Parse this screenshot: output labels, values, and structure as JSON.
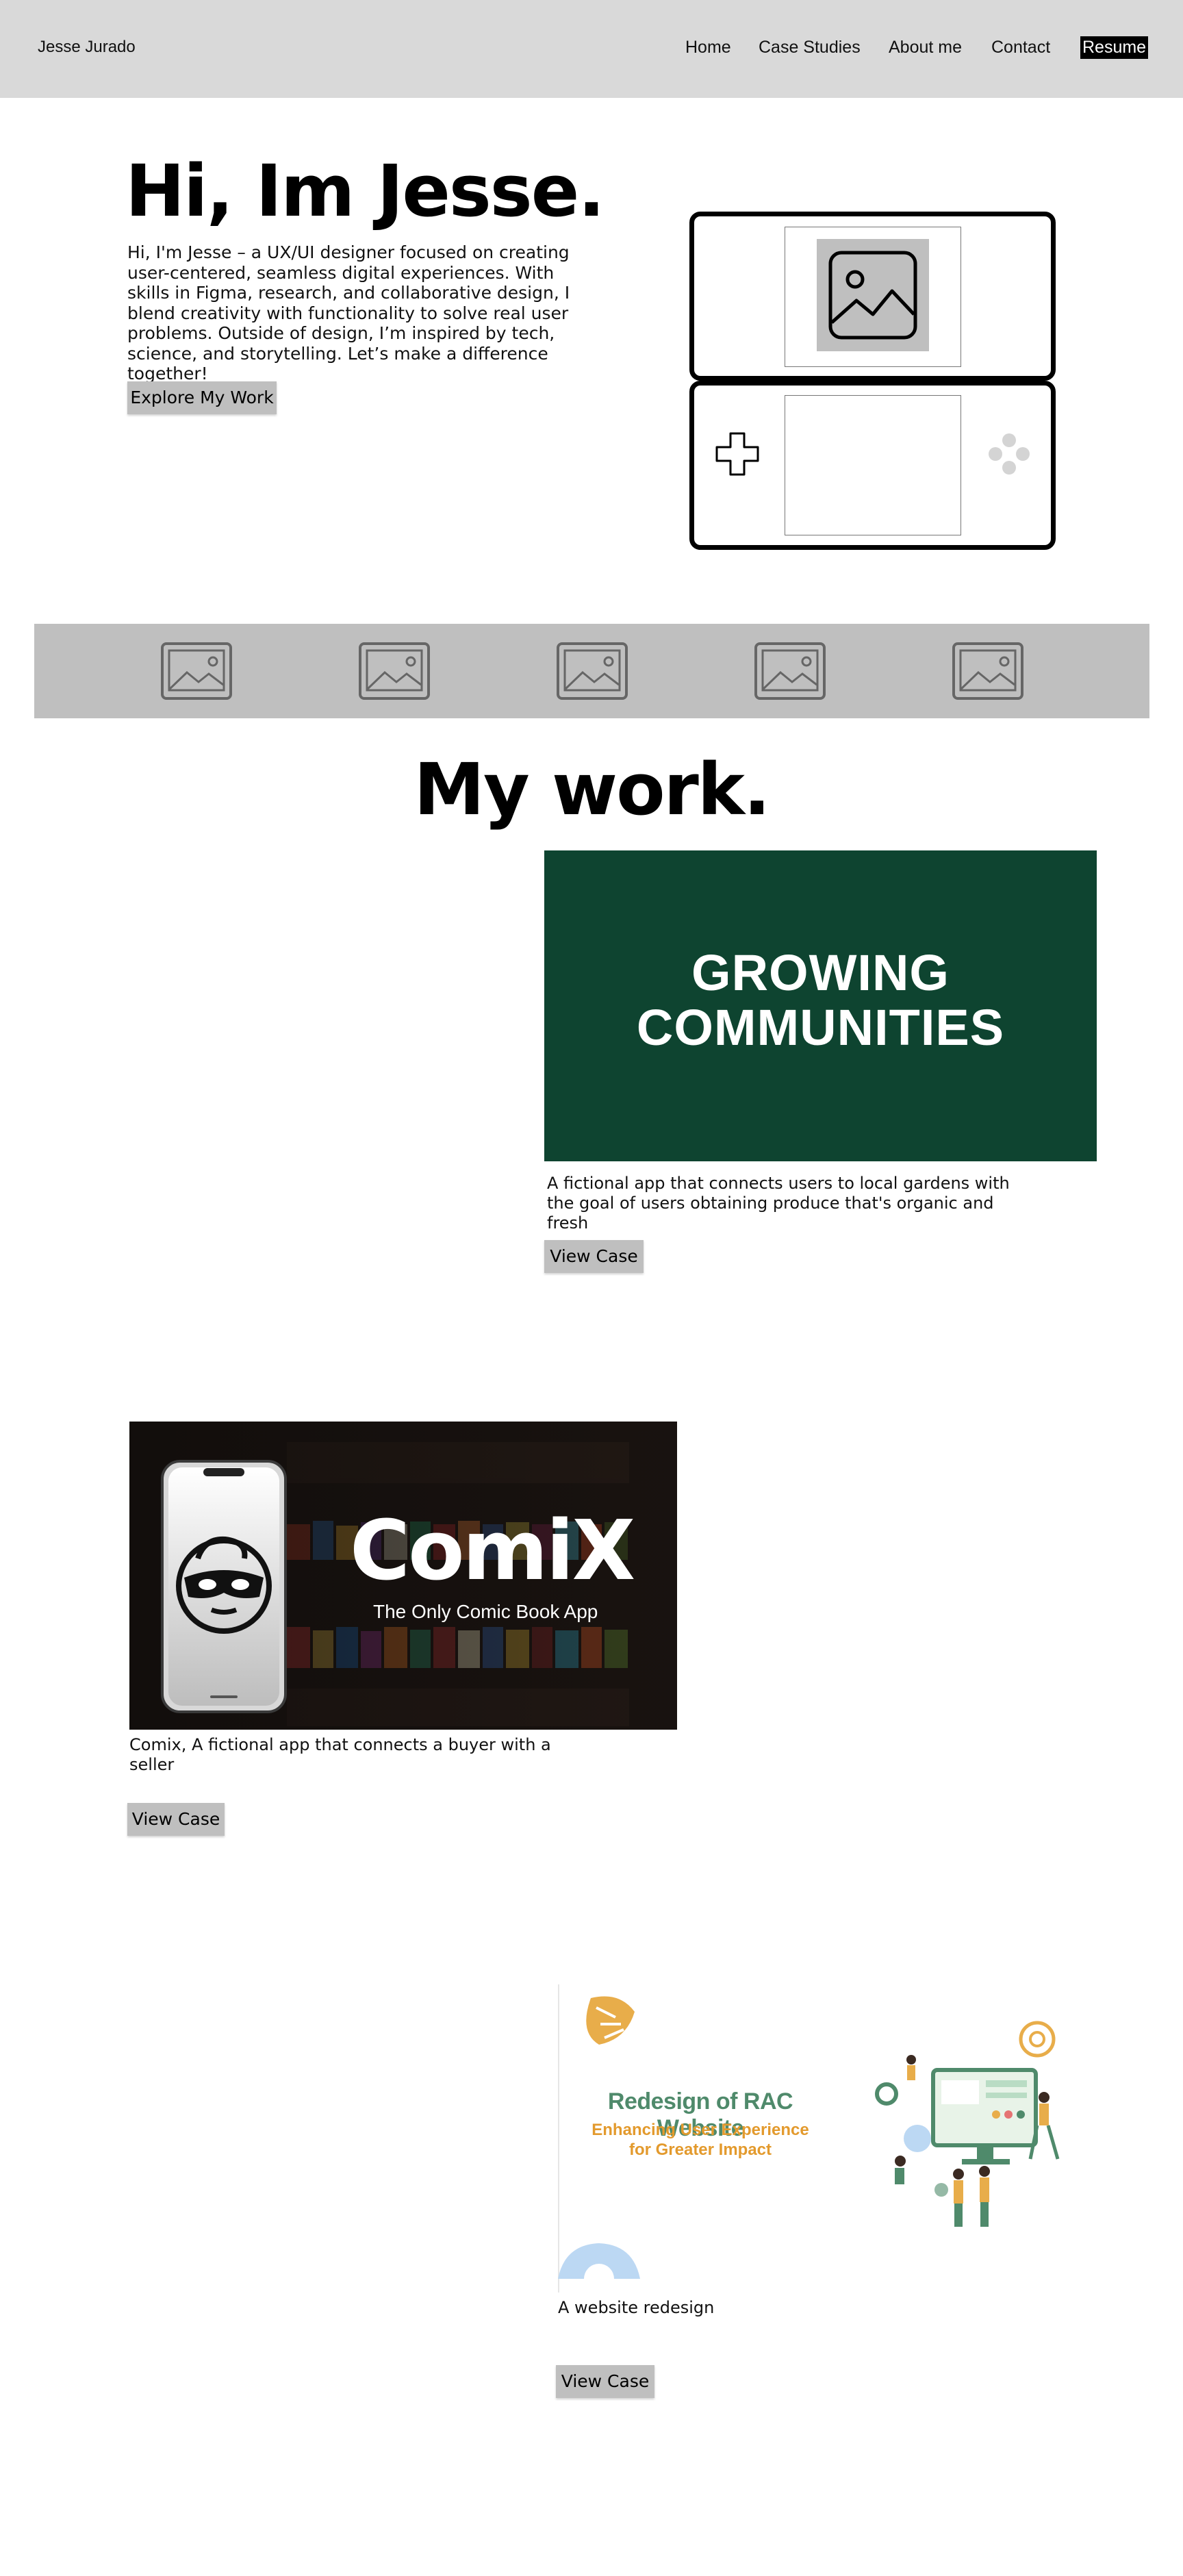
{
  "header": {
    "brand": "Jesse Jurado",
    "nav": [
      "Home",
      "Case Studies",
      "About me",
      "Contact"
    ],
    "resume_label": "Resume"
  },
  "hero": {
    "title": "Hi, Im Jesse.",
    "intro": "Hi, I'm Jesse – a UX/UI designer focused on creating user-centered, seamless digital experiences. With skills in Figma, research, and collaborative design, I blend creativity with functionality to solve real user problems. Outside of design, I’m inspired by tech, science, and storytelling. Let’s make a difference together!",
    "cta": "Explore My Work"
  },
  "icons": {
    "placeholder": "image-placeholder-icon",
    "dpad": "dpad-icon",
    "buttons": "face-buttons-icon"
  },
  "work": {
    "title": "My work.",
    "projects": [
      {
        "image_title_line1": "GROWING",
        "image_title_line2": "COMMUNITIES",
        "description": "A fictional app that connects users to local gardens with the goal of users obtaining produce that's organic and fresh",
        "cta": "View Case",
        "color": "#0e4430"
      },
      {
        "image_title": "ComiX",
        "image_subtitle": "The Only Comic Book App",
        "description": "Comix, A fictional app that connects a buyer with a seller",
        "cta": "View Case"
      },
      {
        "image_title": "Redesign of RAC Website",
        "image_subtitle_line1": "Enhancing User Experience",
        "image_subtitle_line2": "for Greater Impact",
        "description": "A website redesign",
        "cta": "View Case",
        "title_color": "#4f8a6b",
        "subtitle_color": "#e39a2d"
      }
    ]
  }
}
